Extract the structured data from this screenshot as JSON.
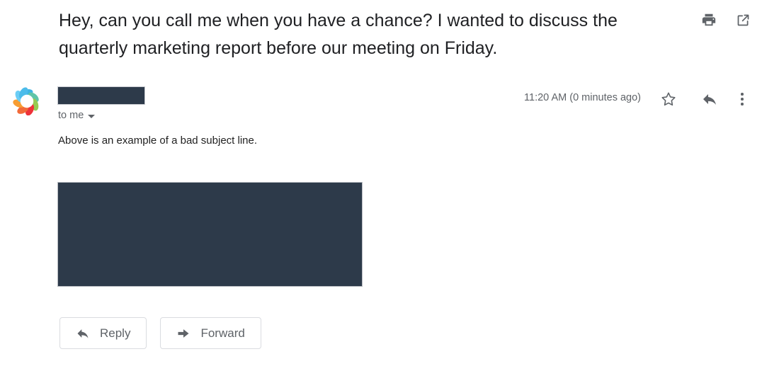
{
  "email": {
    "subject": "Hey, can you call me when you have a chance? I wanted to discuss the quarterly marketing report before our meeting on Friday.",
    "sender_name_redacted": "",
    "recipients_label": "to me",
    "timestamp": "11:20 AM (0 minutes ago)",
    "body_text": "Above is an example of a bad subject line.",
    "signature_redacted": ""
  },
  "header_actions": [
    {
      "name": "print-icon",
      "label": "Print"
    },
    {
      "name": "open-in-new-icon",
      "label": "Open in new window"
    }
  ],
  "message_actions": [
    {
      "name": "star-icon",
      "label": "Star"
    },
    {
      "name": "reply-icon",
      "label": "Reply"
    },
    {
      "name": "more-options-icon",
      "label": "More"
    }
  ],
  "footer": {
    "reply_label": "Reply",
    "forward_label": "Forward"
  },
  "colors": {
    "redaction": "#2d3a4a",
    "icon_gray": "#5f6368",
    "border_gray": "#dadce0",
    "text_primary": "#202124",
    "background": "#ffffff",
    "avatar_blue": "#29abe2",
    "avatar_green": "#8cc63f",
    "avatar_orange": "#f7931e",
    "avatar_red": "#ed1c24"
  }
}
